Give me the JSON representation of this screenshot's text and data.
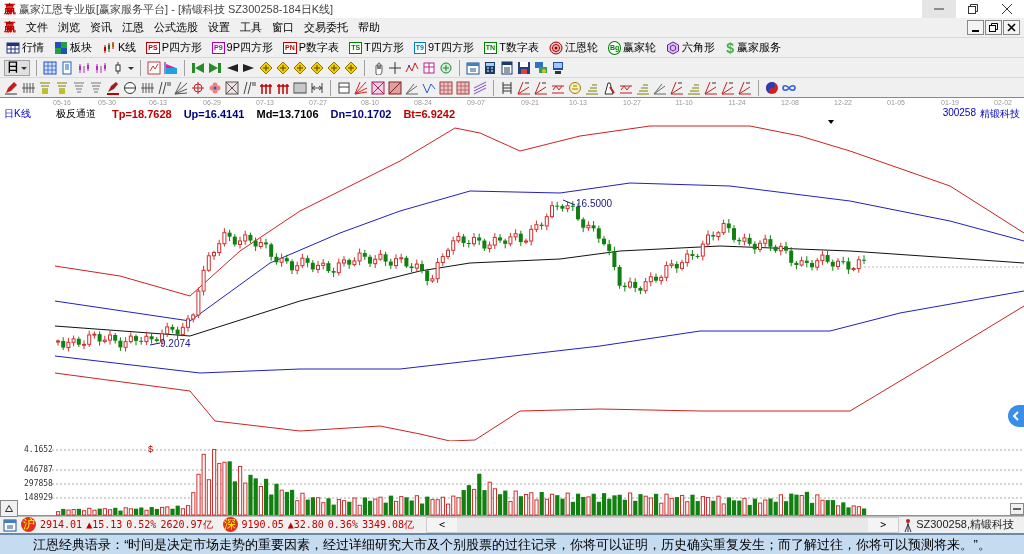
{
  "window": {
    "logo": "赢",
    "title": "赢家江恩专业版[赢家服务平台] - [精锻科技  SZ300258-184日K线]"
  },
  "menu": {
    "logo": "赢",
    "items": [
      "文件",
      "浏览",
      "资讯",
      "江恩",
      "公式选股",
      "设置",
      "工具",
      "窗口",
      "交易委托",
      "帮助"
    ]
  },
  "quick_toolbar": [
    {
      "label": "行情"
    },
    {
      "label": "板块"
    },
    {
      "label": "K线"
    },
    {
      "label": "P四方形",
      "icon_text": "PS",
      "color": "#c00000"
    },
    {
      "label": "9P四方形",
      "icon_text": "P9",
      "color": "#b000b0"
    },
    {
      "label": "P数字表",
      "icon_text": "PN",
      "color": "#c00000"
    },
    {
      "label": "T四方形",
      "icon_text": "TS",
      "color": "#008000"
    },
    {
      "label": "9T四方形",
      "icon_text": "T9",
      "color": "#0080c0"
    },
    {
      "label": "T数字表",
      "icon_text": "TN",
      "color": "#008000"
    },
    {
      "label": "江恩轮"
    },
    {
      "label": "赢家轮",
      "icon_text": "Bg",
      "color": "#008000"
    },
    {
      "label": "六角形"
    },
    {
      "label": "赢家服务",
      "icon_text": "$",
      "color": "#40b040"
    }
  ],
  "period_selector": {
    "label": "日"
  },
  "chart": {
    "period_label": "日K线",
    "dates": [
      "05-16",
      "05-30",
      "06-13",
      "06-29",
      "07-13",
      "07-27",
      "08-10",
      "08-24",
      "09-07",
      "09-21",
      "10-13",
      "10-27",
      "11-10",
      "11-24",
      "12-08",
      "12-22",
      "01-05",
      "01-19",
      "02-02"
    ],
    "indicator": {
      "name": "极反通道",
      "values": [
        {
          "text": "Tp=18.7628",
          "color": "#c00000"
        },
        {
          "text": "Up=16.4141",
          "color": "#000080"
        },
        {
          "text": "Md=13.7106",
          "color": "#000000"
        },
        {
          "text": "Dn=10.1702",
          "color": "#000080"
        },
        {
          "text": "Bt=6.9242",
          "color": "#c00000"
        }
      ]
    },
    "stock_code": "300258",
    "stock_name": "精锻科技",
    "high_label": "16.5000",
    "low_label": "9.2074"
  },
  "volume": {
    "axis_labels": [
      "4.1652",
      "446787",
      "297858",
      "148929"
    ],
    "marker": "$"
  },
  "status_bar": {
    "indices": [
      {
        "badge": "沪",
        "value": "2914.01",
        "change": "▲15.13",
        "percent": "0.52%",
        "amount": "2620.97亿"
      },
      {
        "badge": "深",
        "value": "9190.05",
        "change": "▲32.80",
        "percent": "0.36%",
        "amount": "3349.08亿"
      }
    ],
    "scroll_left": "<",
    "scroll_right": ">",
    "stock": "SZ300258,精锻科技"
  },
  "quote": "江恩经典语录：“时间是决定市场走势的重要因素，经过详细研究大市及个别股票的过往记录，你将可以证明，历史确实重复发生；而了解过往，你将可以预测将来。”。"
}
